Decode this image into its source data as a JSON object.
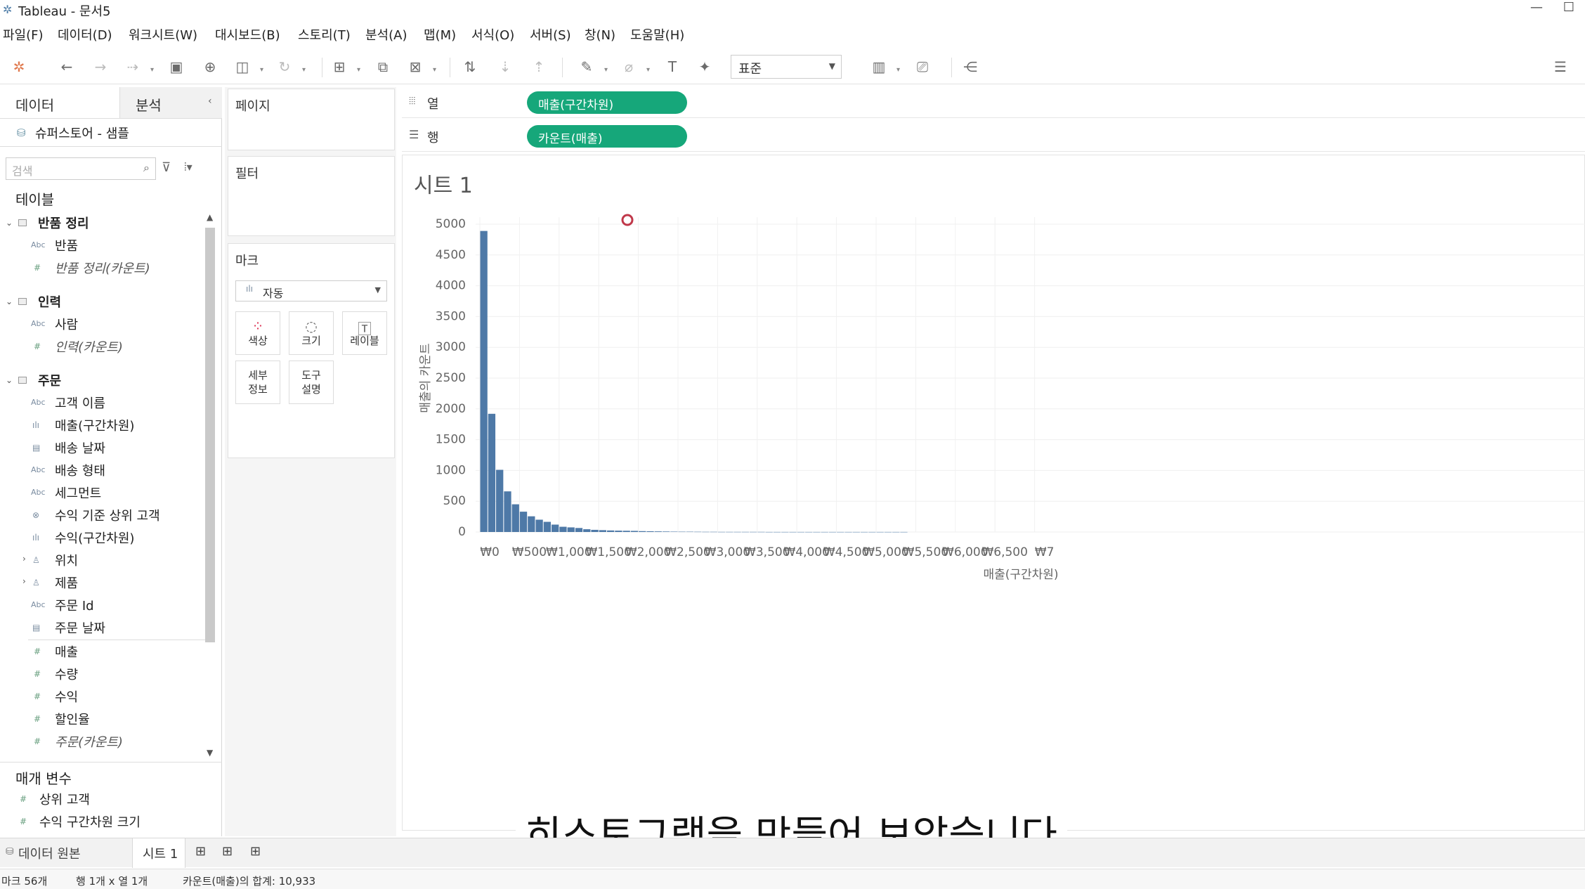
{
  "window": {
    "title": "Tableau - 문서5"
  },
  "menu": [
    "파일(F)",
    "데이터(D)",
    "워크시트(W)",
    "대시보드(B)",
    "스토리(T)",
    "분석(A)",
    "맵(M)",
    "서식(O)",
    "서버(S)",
    "창(N)",
    "도움말(H)"
  ],
  "toolbar": {
    "fit_select": "표준"
  },
  "data_pane": {
    "tab_data": "데이터",
    "tab_analysis": "분석",
    "datasource": "슈퍼스토어 - 샘플",
    "search_placeholder": "검색",
    "tables_header": "테이블",
    "groups": [
      {
        "name": "반품 정리",
        "items": [
          {
            "icon": "Abc",
            "label": "반품"
          },
          {
            "icon": "#",
            "label": "반품 정리(카운트)",
            "italic": true
          }
        ]
      },
      {
        "name": "인력",
        "items": [
          {
            "icon": "Abc",
            "label": "사람"
          },
          {
            "icon": "#",
            "label": "인력(카운트)",
            "italic": true
          }
        ]
      },
      {
        "name": "주문",
        "items": [
          {
            "icon": "Abc",
            "label": "고객 이름"
          },
          {
            "icon": "bin",
            "label": "매출(구간차원)"
          },
          {
            "icon": "date",
            "label": "배송 날짜"
          },
          {
            "icon": "Abc",
            "label": "배송 형태"
          },
          {
            "icon": "Abc",
            "label": "세그먼트"
          },
          {
            "icon": "set",
            "label": "수익 기준 상위 고객"
          },
          {
            "icon": "bin",
            "label": "수익(구간차원)"
          },
          {
            "icon": "geo",
            "label": "위치"
          },
          {
            "icon": "geo",
            "label": "제품"
          },
          {
            "icon": "Abc",
            "label": "주문 Id"
          },
          {
            "icon": "date",
            "label": "주문 날짜"
          },
          {
            "icon": "#",
            "label": "매출"
          },
          {
            "icon": "#",
            "label": "수량"
          },
          {
            "icon": "#",
            "label": "수익"
          },
          {
            "icon": "#",
            "label": "할인율"
          },
          {
            "icon": "#",
            "label": "주문(카운트)",
            "italic": true
          }
        ]
      }
    ],
    "params_header": "매개 변수",
    "params": [
      "상위 고객",
      "수익 구간차원 크기"
    ]
  },
  "cards": {
    "pages": "페이지",
    "filters": "필터",
    "marks": "마크",
    "mark_type": "자동",
    "buttons": {
      "color": "색상",
      "size": "크기",
      "label": "레이블",
      "detail_1": "세부",
      "detail_2": "정보",
      "tooltip_1": "도구",
      "tooltip_2": "설명"
    }
  },
  "shelves": {
    "columns_label": "열",
    "columns_pill": "매출(구간차원)",
    "rows_label": "행",
    "rows_pill": "카운트(매출)"
  },
  "sheet": {
    "title": "시트 1"
  },
  "chart_data": {
    "type": "bar",
    "title": "",
    "ylabel": "매출의 카운트",
    "xlabel": "매출(구간차원)",
    "ylim": [
      0,
      5000
    ],
    "yticks": [
      0,
      500,
      1000,
      1500,
      2000,
      2500,
      3000,
      3500,
      4000,
      4500,
      5000
    ],
    "xticks": [
      "₩0",
      "₩500",
      "₩1,000",
      "₩1,500",
      "₩2,000",
      "₩2,500",
      "₩3,000",
      "₩3,500",
      "₩4,000",
      "₩4,500",
      "₩5,000",
      "₩5,500",
      "₩6,000",
      "₩6,500",
      "₩7"
    ],
    "bin_width": 100,
    "values": [
      4890,
      1920,
      1010,
      660,
      450,
      330,
      255,
      200,
      165,
      120,
      85,
      75,
      65,
      45,
      35,
      30,
      25,
      22,
      20,
      18,
      14,
      12,
      10,
      8,
      6,
      5,
      5,
      4,
      3,
      3,
      2,
      2,
      2,
      2,
      2,
      2,
      1,
      1,
      1,
      1,
      1,
      1,
      1,
      1,
      1,
      1,
      1,
      1,
      1,
      1,
      1,
      1,
      1,
      1
    ]
  },
  "caption": "히스토그램을 만들어 보았습니다",
  "bottom_tabs": {
    "datasource": "데이터 원본",
    "sheet": "시트 1"
  },
  "status": {
    "marks": "마크 56개",
    "rows_cols": "행 1개 x 열 1개",
    "sum": "카운트(매출)의 합계: 10,933"
  },
  "colors": {
    "bar": "#4e79a7",
    "pill": "#16a77a"
  }
}
